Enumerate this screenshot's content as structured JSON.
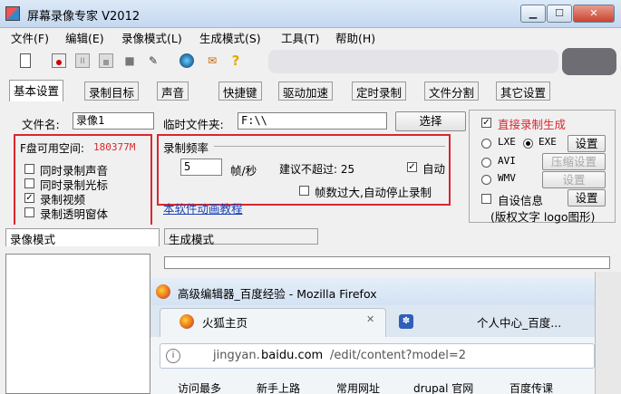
{
  "window": {
    "title": "屏幕录像专家 V2012"
  },
  "menu": [
    "文件(F)",
    "编辑(E)",
    "录像模式(L)",
    "生成模式(S)",
    "工具(T)",
    "帮助(H)"
  ],
  "toolbar_icons": [
    "new-icon",
    "record-icon",
    "pause-icon",
    "stop-icon",
    "camera-icon",
    "pen-icon",
    "globe-icon",
    "mail-icon",
    "help-icon"
  ],
  "tabs": [
    "基本设置",
    "录制目标",
    "声音",
    "快捷键",
    "驱动加速",
    "定时录制",
    "文件分割",
    "其它设置"
  ],
  "basic": {
    "filename_label": "文件名:",
    "filename_value": "录像1",
    "temp_label": "临时文件夹:",
    "temp_value": "F:\\\\",
    "select_button": "选择",
    "disk_label": "F盘可用空间:",
    "disk_value": "180377M",
    "options": [
      {
        "label": "同时录制声音",
        "checked": false
      },
      {
        "label": "同时录制光标",
        "checked": false
      },
      {
        "label": "录制视频",
        "checked": true
      },
      {
        "label": "录制透明窗体",
        "checked": false
      }
    ],
    "framerate_title": "录制频率",
    "framerate_value": "5",
    "framerate_unit": "帧/秒",
    "suggest_label": "建议不超过: 25",
    "auto_label": "自动",
    "auto_checked": true,
    "auto_stop_label": "帧数过大,自动停止录制",
    "tutorial_link": "本软件动画教程"
  },
  "output": {
    "direct_label": "直接录制生成",
    "direct_checked": true,
    "formats": [
      {
        "label": "LXE",
        "selected": false
      },
      {
        "label": "EXE",
        "selected": true
      },
      {
        "label": "AVI",
        "selected": false
      },
      {
        "label": "WMV",
        "selected": false
      }
    ],
    "settings_button": "设置",
    "compress_button": "压缩设置",
    "settings_button_disabled": "设置",
    "custom_info_label": "自设信息",
    "custom_settings_button": "设置",
    "copyright_label": "(版权文字 logo图形)"
  },
  "modes": {
    "record_tab": "录像模式",
    "generate_tab": "生成模式"
  },
  "firefox": {
    "title": "高级编辑器_百度经验 - Mozilla Firefox",
    "tab1": "火狐主页",
    "tab2": "个人中心_百度...",
    "close_mark": "✕",
    "url_prefix": "jingyan.",
    "url_domain": "baidu.com",
    "url_path": "/edit/content?model=2",
    "bookmarks": [
      "访问最多",
      "新手上路",
      "常用网址",
      "drupal 官网",
      "百度传课"
    ]
  },
  "colors": {
    "highlight": "#d9272f",
    "disk_value": "#d9272f",
    "direct": "#d9272f",
    "link": "#1a3fb5"
  }
}
